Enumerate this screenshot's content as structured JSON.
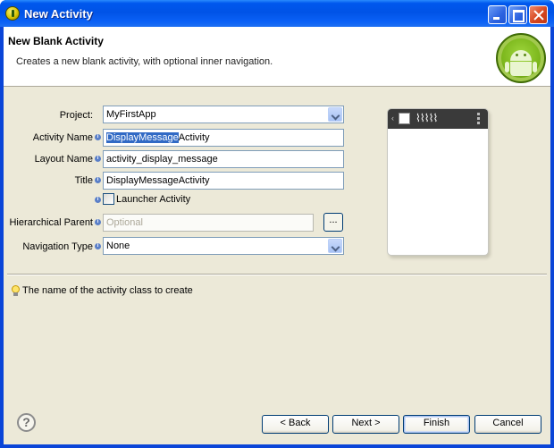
{
  "window": {
    "title": "New Activity"
  },
  "header": {
    "title": "New Blank Activity",
    "description": "Creates a new blank activity, with optional inner navigation."
  },
  "form": {
    "project": {
      "label": "Project:",
      "value": "MyFirstApp"
    },
    "activity_name": {
      "label": "Activity Name",
      "value_selected": "DisplayMessage",
      "value_rest": "Activity"
    },
    "layout_name": {
      "label": "Layout Name",
      "value": "activity_display_message"
    },
    "title": {
      "label": "Title",
      "value": "DisplayMessageActivity"
    },
    "launcher_activity": {
      "label": "Launcher Activity",
      "checked": false
    },
    "hierarchical_parent": {
      "label": "Hierarchical Parent",
      "placeholder": "Optional",
      "browse_label": "..."
    },
    "navigation_type": {
      "label": "Navigation Type",
      "value": "None"
    }
  },
  "preview": {
    "back_glyph": "‹",
    "title_glyph": "⌇⌇⌇⌇⌇"
  },
  "hint": {
    "text": "The name of the activity class to create"
  },
  "buttons": {
    "help": "?",
    "back": "< Back",
    "next": "Next >",
    "finish": "Finish",
    "cancel": "Cancel"
  },
  "colors": {
    "titlebar": "#0058ee",
    "dialog": "#ece9d8",
    "selection": "#316ac5",
    "android_green": "#7bb61b"
  }
}
